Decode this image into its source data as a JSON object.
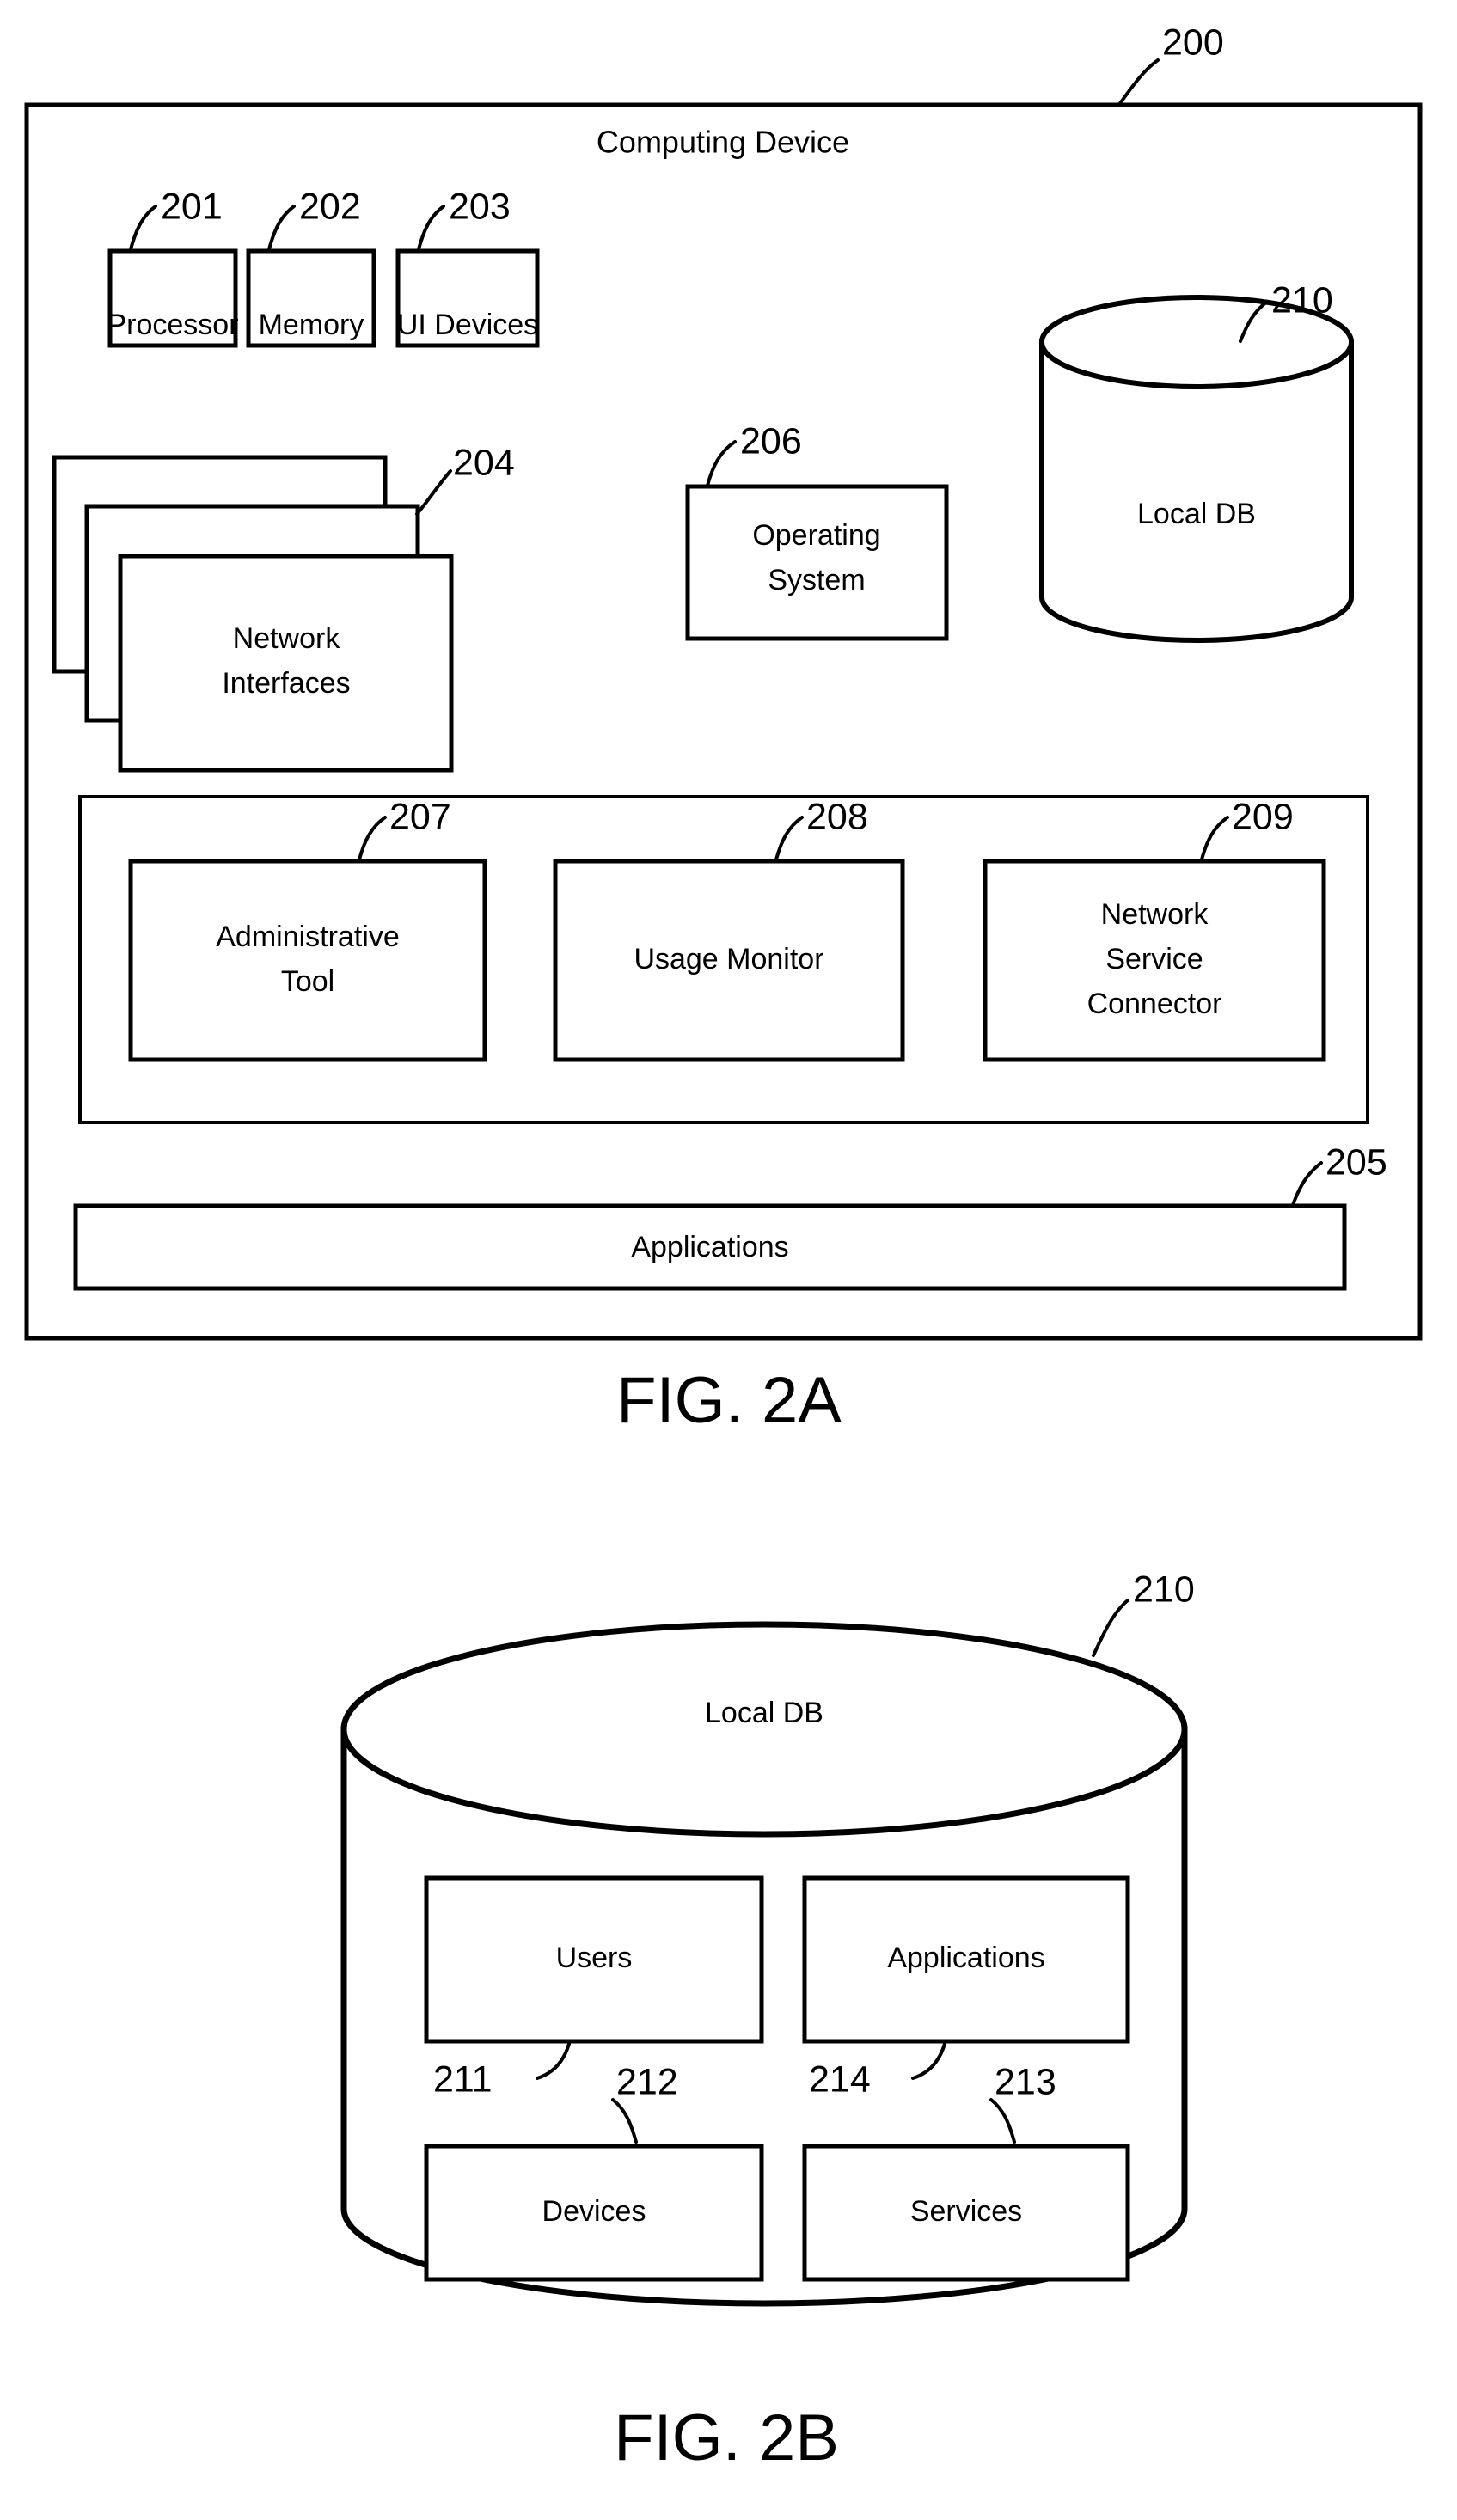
{
  "figures": [
    {
      "id": "fig-2a",
      "label": "FIG. 2A",
      "container": {
        "ref": "200",
        "title": "Computing Device"
      },
      "components": [
        {
          "ref": "201",
          "label": "Processor"
        },
        {
          "ref": "202",
          "label": "Memory"
        },
        {
          "ref": "203",
          "label": "UI Devices"
        },
        {
          "ref": "204",
          "label": "Network Interfaces"
        },
        {
          "ref": "206",
          "label_line1": "Operating",
          "label_line2": "System"
        },
        {
          "ref": "210",
          "label": "Local DB"
        },
        {
          "ref": "207",
          "label_line1": "Administrative",
          "label_line2": "Tool"
        },
        {
          "ref": "208",
          "label": "Usage Monitor"
        },
        {
          "ref": "209",
          "label_line1": "Network",
          "label_line2": "Service",
          "label_line3": "Connector"
        },
        {
          "ref": "205",
          "label": "Applications"
        }
      ]
    },
    {
      "id": "fig-2b",
      "label": "FIG. 2B",
      "container": {
        "ref": "210",
        "title": "Local DB"
      },
      "tables": [
        {
          "ref": "211",
          "label": "Users"
        },
        {
          "ref": "214",
          "label": "Applications"
        },
        {
          "ref": "212",
          "label": "Devices"
        },
        {
          "ref": "213",
          "label": "Services"
        }
      ]
    }
  ],
  "fig2a": {
    "ref_200": "200",
    "title": "Computing Device",
    "ref_201": "201",
    "label_201": "Processor",
    "ref_202": "202",
    "label_202": "Memory",
    "ref_203": "203",
    "label_203": "UI Devices",
    "ref_204": "204",
    "label_204_line1": "Network",
    "label_204_line2": "Interfaces",
    "ref_206": "206",
    "label_206_line1": "Operating",
    "label_206_line2": "System",
    "ref_210": "210",
    "label_210": "Local DB",
    "ref_207": "207",
    "label_207_line1": "Administrative",
    "label_207_line2": "Tool",
    "ref_208": "208",
    "label_208": "Usage Monitor",
    "ref_209": "209",
    "label_209_line1": "Network",
    "label_209_line2": "Service",
    "label_209_line3": "Connector",
    "ref_205": "205",
    "label_205": "Applications",
    "fig_label": "FIG. 2A"
  },
  "fig2b": {
    "ref_210": "210",
    "label_210": "Local DB",
    "ref_211": "211",
    "label_211": "Users",
    "ref_212": "212",
    "label_212": "Devices",
    "ref_213": "213",
    "label_213": "Services",
    "ref_214": "214",
    "label_214": "Applications",
    "fig_label": "FIG. 2B"
  },
  "colors": {
    "ink": "#000000",
    "paper": "#ffffff"
  }
}
